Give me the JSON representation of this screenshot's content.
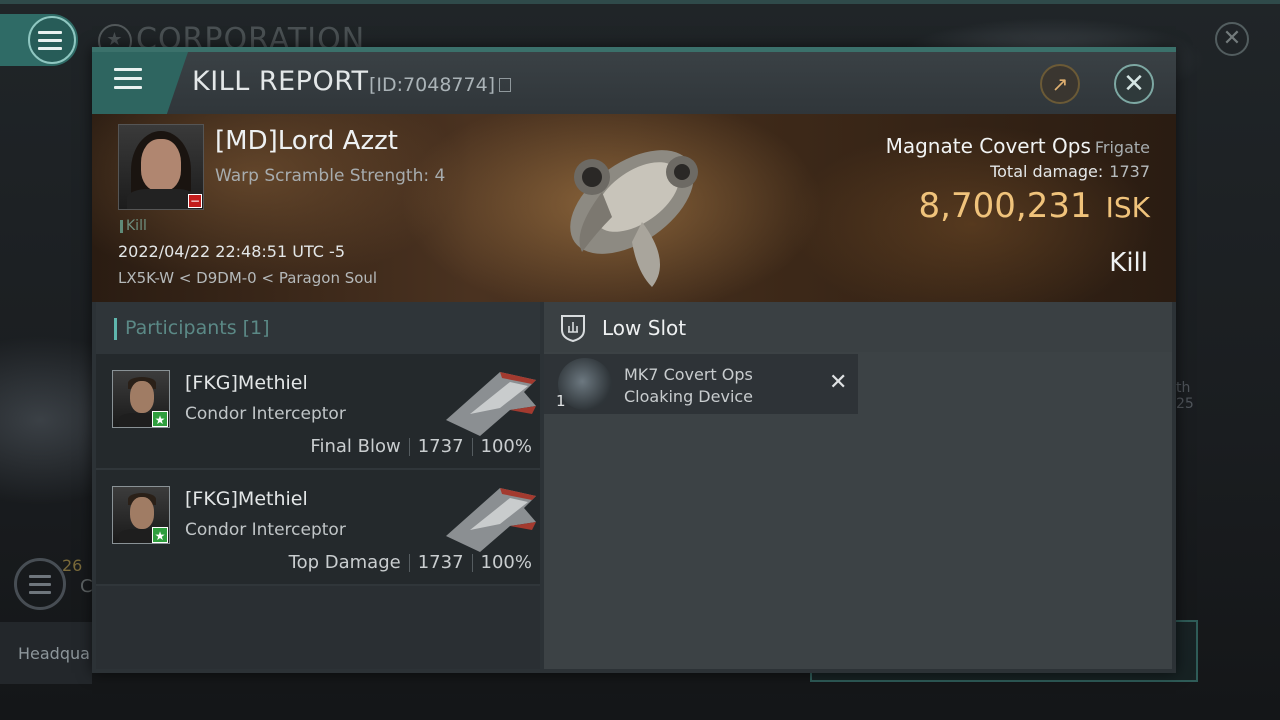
{
  "background": {
    "corp_title": "CORPORATION",
    "corp_count": "26",
    "corp_letter": "C",
    "hq_label": "Headqua",
    "side_text_a": "th",
    "side_text_b": "25"
  },
  "window": {
    "title": "KILL REPORT",
    "id_label": "[ID:7048774]"
  },
  "victim": {
    "name": "[MD]Lord Azzt",
    "warp_scramble": "Warp Scramble Strength: 4",
    "tag": "Kill",
    "datetime": "2022/04/22 22:48:51 UTC -5",
    "location": "LX5K-W < D9DM-0 < Paragon Soul"
  },
  "ship": {
    "name": "Magnate Covert Ops",
    "class": "Frigate",
    "total_damage_label": "Total damage:",
    "total_damage_value": "1737",
    "isk_value": "8,700,231",
    "isk_unit": "ISK",
    "result": "Kill"
  },
  "participants": {
    "header": "Participants [1]",
    "rows": [
      {
        "name": "[FKG]Methiel",
        "ship": "Condor Interceptor",
        "role": "Final Blow",
        "damage": "1737",
        "percent": "100%"
      },
      {
        "name": "[FKG]Methiel",
        "ship": "Condor Interceptor",
        "role": "Top Damage",
        "damage": "1737",
        "percent": "100%"
      }
    ]
  },
  "low_slot": {
    "header": "Low Slot",
    "module_name": "MK7 Covert Ops Cloaking Device",
    "module_qty": "1"
  },
  "colors": {
    "accent_teal": "#2e6560",
    "isk_gold": "#f0c37b",
    "negative_red": "#c21c1c",
    "positive_green": "#2f9e3e"
  }
}
